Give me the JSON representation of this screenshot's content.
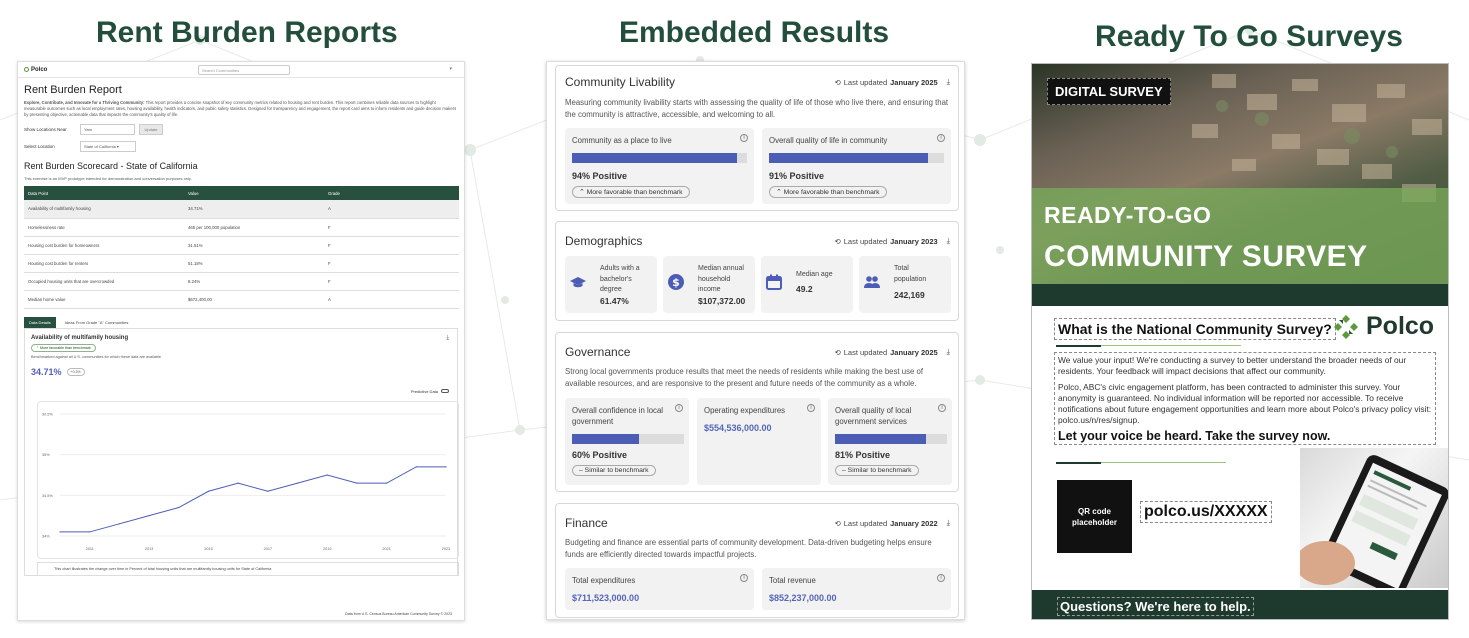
{
  "titles": {
    "col1": "Rent Burden Reports",
    "col2": "Embedded Results",
    "col3": "Ready To Go Surveys"
  },
  "rent_report": {
    "logo": "Polco",
    "search_placeholder": "Search Communities",
    "heading": "Rent Burden Report",
    "intro_bold": "Explore, Contribute, and Innovate for a Thriving Community:",
    "intro": "This report provides a concise snapshot of key community metrics related to housing and rent burden. This report combines reliable data sources to highlight measurable outcomes such as local employment rates, housing availability, health indicators, and public safety statistics. Designed for transparency and engagement, the report card aims to inform residents and guide decision makers by presenting objective, actionable data that impacts the community's quality of life.",
    "show_locations_label": "Show Locations Near",
    "show_locations_value": "Yarn",
    "update_button": "Update",
    "select_location_label": "Select Location",
    "select_location_value": "State of California",
    "scorecard_title": "Rent Burden Scorecard - State of California",
    "scorecard_note": "This exercise is an MVP prototype intended for demonstration and conversation purposes only.",
    "table_headers": [
      "Data Point",
      "Value",
      "Grade"
    ],
    "table_rows": [
      [
        "Availability of multifamily housing",
        "34.71%",
        "A"
      ],
      [
        "Homelessness rate",
        "465 per 100,000 population",
        "F"
      ],
      [
        "Housing cost burden for homeowners",
        "31.51%",
        "F"
      ],
      [
        "Housing cost burden for renters",
        "51.18%",
        "F"
      ],
      [
        "Occupied housing units that are overcrowded",
        "8.24%",
        "F"
      ],
      [
        "Median home value",
        "$672,400.00",
        "A"
      ]
    ],
    "tab_active": "Data Details",
    "tab_other": "Ideas From Grade \"A\" Communities",
    "detail_title": "Availability of multifamily housing",
    "detail_pill": "More favorable than benchmark",
    "detail_small": "Benchmarked against all U.S. communities for which these data are available",
    "detail_value": "34.71%",
    "detail_chip": "+0.3%",
    "predictive_label": "Predictive Data",
    "caption_text": "This chart illustrates the change over time in Percent of total housing units that are multifamily housing units for State of California",
    "source": "Data from U.S. Census Bureau American Community Survey © 2023"
  },
  "chart_data": {
    "type": "line",
    "x": [
      2010,
      2011,
      2012,
      2013,
      2014,
      2015,
      2016,
      2017,
      2018,
      2019,
      2020,
      2021,
      2022,
      2023
    ],
    "series": [
      {
        "values": [
          32.6,
          32.6,
          32.8,
          33.0,
          33.2,
          33.6,
          33.8,
          33.6,
          33.8,
          34.0,
          33.8,
          33.8,
          34.2,
          34.2
        ]
      }
    ],
    "xticks": [
      "2011",
      "2013",
      "2015",
      "2017",
      "2019",
      "2021",
      "2023"
    ],
    "yticks": [
      "30.5%",
      "35%",
      "34.5%",
      "34%"
    ],
    "ylim": [
      32.5,
      35.5
    ],
    "title": "",
    "xlabel": "",
    "ylabel": ""
  },
  "embedded": {
    "livability": {
      "title": "Community Livability",
      "updated_label": "Last updated",
      "updated_date": "January 2025",
      "desc": "Measuring community livability starts with assessing the quality of life of those who live there, and ensuring that the community is attractive, accessible, and welcoming to all.",
      "cards": [
        {
          "label": "Community as a place to live",
          "fill": 0.94,
          "positive": "94% Positive",
          "bench": "More favorable than benchmark"
        },
        {
          "label": "Overall quality of life in community",
          "fill": 0.91,
          "positive": "91% Positive",
          "bench": "More favorable than benchmark"
        }
      ]
    },
    "demographics": {
      "title": "Demographics",
      "updated_label": "Last updated",
      "updated_date": "January 2023",
      "items": [
        {
          "label": "Adults with a bachelor's degree",
          "value": "61.47%",
          "icon": "graduation-cap-icon"
        },
        {
          "label": "Median annual household income",
          "value": "$107,372.00",
          "icon": "dollar-icon"
        },
        {
          "label": "Median age",
          "value": "49.2",
          "icon": "calendar-icon"
        },
        {
          "label": "Total population",
          "value": "242,169",
          "icon": "people-icon"
        }
      ]
    },
    "governance": {
      "title": "Governance",
      "updated_label": "Last updated",
      "updated_date": "January 2025",
      "desc": "Strong local governments produce results that meet the needs of residents while making the best use of available resources, and are responsive to the present and future needs of the community as a whole.",
      "cards": [
        {
          "label": "Overall confidence in local government",
          "fill": 0.6,
          "positive": "60% Positive",
          "bench": "Similar to benchmark"
        },
        {
          "label": "Operating expenditures",
          "money": "$554,536,000.00"
        },
        {
          "label": "Overall quality of local government services",
          "fill": 0.81,
          "positive": "81% Positive",
          "bench": "Similar to benchmark"
        }
      ]
    },
    "finance": {
      "title": "Finance",
      "updated_label": "Last updated",
      "updated_date": "January 2022",
      "desc": "Budgeting and finance are essential parts of community development. Data-driven budgeting helps ensure funds are efficiently directed towards impactful projects.",
      "cards": [
        {
          "label": "Total expenditures",
          "money": "$711,523,000.00"
        },
        {
          "label": "Total revenue",
          "money": "$852,237,000.00"
        }
      ]
    }
  },
  "survey": {
    "badge": "DIGITAL SURVEY",
    "line1": "READY-TO-GO",
    "line2": "COMMUNITY SURVEY",
    "question": "What is the National Community Survey?",
    "brand": "Polco",
    "p1": "We value your input! We're conducting a survey to better understand the broader needs of our residents. Your feedback will impact decisions that affect our community.",
    "p2": "Polco, ABC's civic engagement platform, has been contracted to administer this survey. Your anonymity is guaranteed. No individual information will be reported nor accessible. To receive notifications about future engagement opportunities and learn more about Polco's privacy policy visit: polco.us/n/res/signup.",
    "cta": "Let your voice be heard. Take the survey now.",
    "qr": "QR code placeholder",
    "url": "polco.us/XXXXX",
    "footer": "Questions? We're here to help."
  }
}
